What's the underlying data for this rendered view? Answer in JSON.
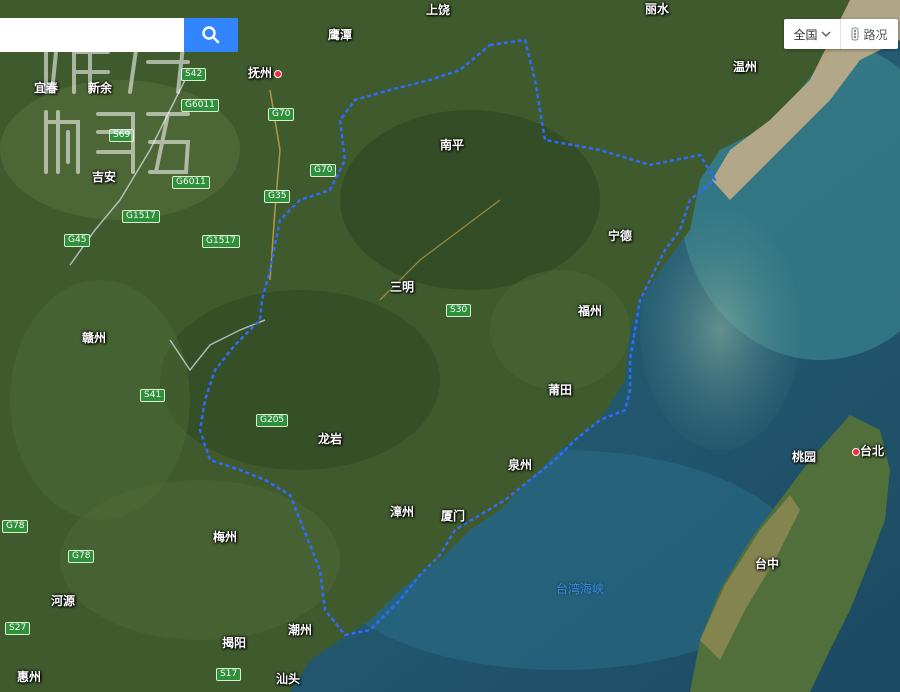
{
  "search": {
    "value": "",
    "placeholder": "",
    "icon": "search-icon",
    "button_color": "#3385ff"
  },
  "controls": {
    "scope_label": "全国",
    "traffic_label": "路况"
  },
  "boundary_color": "#2f6bff",
  "cities": [
    {
      "id": "shangrao",
      "name": "上饶"
    },
    {
      "id": "lishui",
      "name": "丽水"
    },
    {
      "id": "yingtan",
      "name": "鹰潭"
    },
    {
      "id": "fuzhou-jx",
      "name": "抚州"
    },
    {
      "id": "yichun",
      "name": "宜春"
    },
    {
      "id": "xinyu",
      "name": "新余"
    },
    {
      "id": "wenzhou",
      "name": "温州"
    },
    {
      "id": "nanping",
      "name": "南平"
    },
    {
      "id": "jian",
      "name": "吉安"
    },
    {
      "id": "ningde",
      "name": "宁德"
    },
    {
      "id": "sanming",
      "name": "三明"
    },
    {
      "id": "fuzhou",
      "name": "福州"
    },
    {
      "id": "ganzhou",
      "name": "赣州"
    },
    {
      "id": "putian",
      "name": "莆田"
    },
    {
      "id": "longyan",
      "name": "龙岩"
    },
    {
      "id": "taipei",
      "name": "台北"
    },
    {
      "id": "taoyuan",
      "name": "桃园"
    },
    {
      "id": "quanzhou",
      "name": "泉州"
    },
    {
      "id": "zhangzhou",
      "name": "漳州"
    },
    {
      "id": "xiamen",
      "name": "厦门"
    },
    {
      "id": "meizhou",
      "name": "梅州"
    },
    {
      "id": "taizhong",
      "name": "台中"
    },
    {
      "id": "heyuan",
      "name": "河源"
    },
    {
      "id": "jieyang",
      "name": "揭阳"
    },
    {
      "id": "chaozhou",
      "name": "潮州"
    },
    {
      "id": "shantou",
      "name": "汕头"
    },
    {
      "id": "huizhou",
      "name": "惠州"
    }
  ],
  "roads": [
    "S42",
    "G6011",
    "G70",
    "S69",
    "G70",
    "G6011",
    "G35",
    "G1517",
    "G1517",
    "G45",
    "S30",
    "S41",
    "G205",
    "G78",
    "G78",
    "S27",
    "S17"
  ],
  "sea_label": "台湾海峡"
}
